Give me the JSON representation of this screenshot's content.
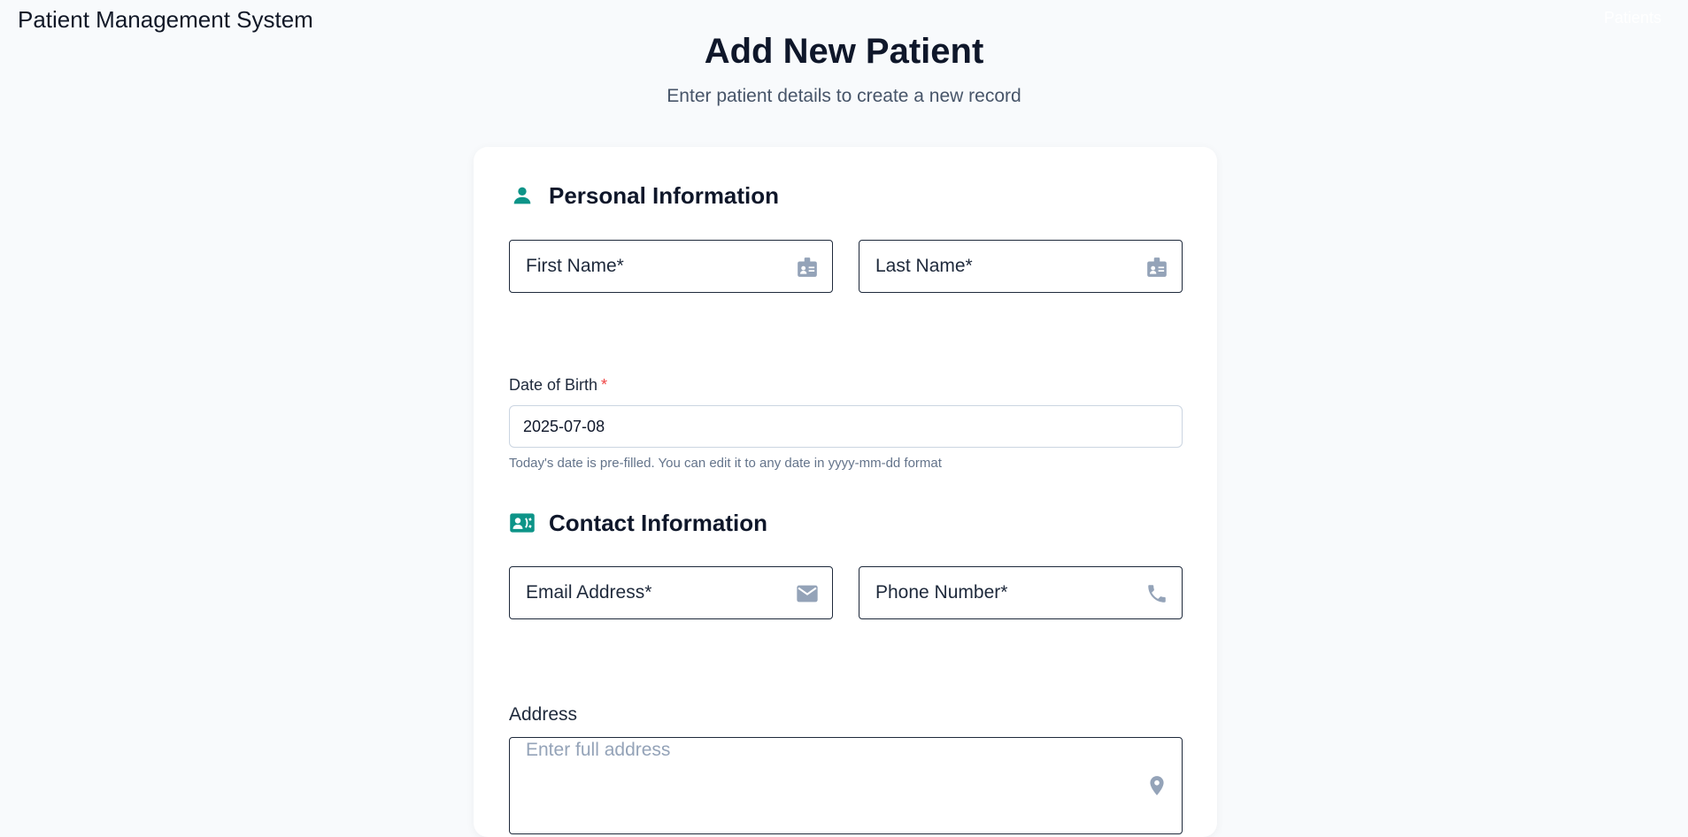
{
  "header": {
    "app_title": "Patient Management System",
    "nav_patients_label": "Patients"
  },
  "page": {
    "title": "Add New Patient",
    "subtitle": "Enter patient details to create a new record"
  },
  "personal_info": {
    "heading": "Personal Information",
    "heading_icon": "person-icon",
    "first_name": {
      "label": "First Name*",
      "icon": "badge-icon"
    },
    "last_name": {
      "label": "Last Name*",
      "icon": "badge-icon"
    },
    "date_of_birth": {
      "label": "Date of Birth",
      "required_mark": "*",
      "value": "2025-07-08",
      "hint": "Today's date is pre-filled. You can edit it to any date in yyyy-mm-dd format"
    }
  },
  "contact_info": {
    "heading": "Contact Information",
    "heading_icon": "contact-card-icon",
    "email": {
      "label": "Email Address*",
      "icon": "mail-icon"
    },
    "phone": {
      "label": "Phone Number*",
      "icon": "phone-icon"
    },
    "address": {
      "label": "Address",
      "placeholder": "Enter full address",
      "icon": "location-pin-icon"
    }
  },
  "colors": {
    "accent": "#0d9488",
    "field_icon": "#94a3b8",
    "required": "#ef4444",
    "background": "#f8fafc"
  }
}
